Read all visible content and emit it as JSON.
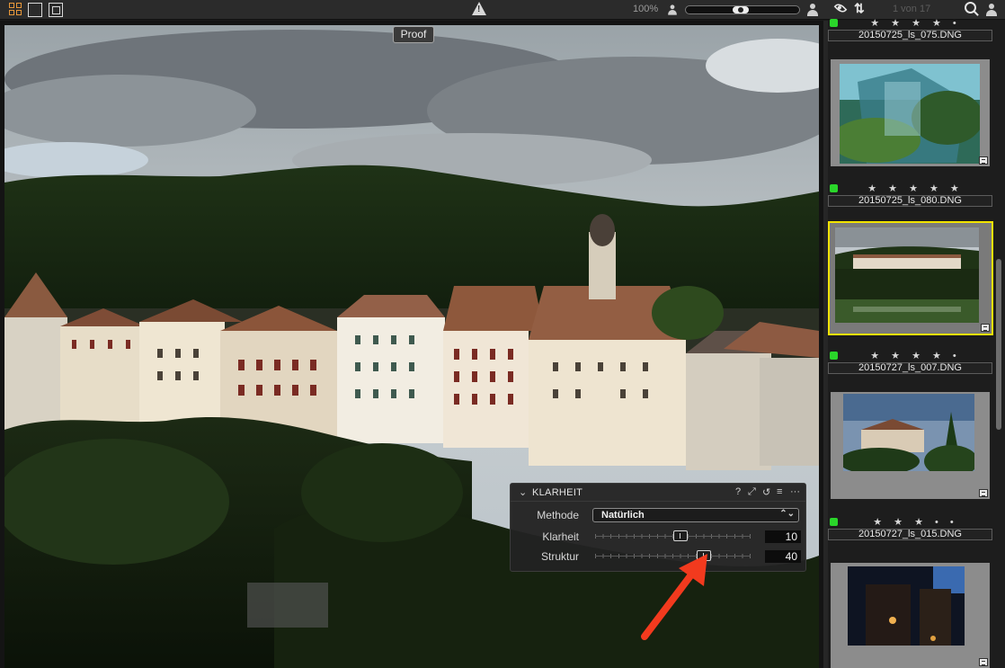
{
  "toolbar": {
    "zoom": "100%",
    "count": "1 von 17"
  },
  "viewer": {
    "proof_label": "Proof"
  },
  "clarity_panel": {
    "title": "KLARHEIT",
    "header_icons": [
      "help-icon",
      "adjust-icon",
      "reset-icon",
      "list-icon",
      "more-icon"
    ],
    "help_glyph": "?",
    "more_glyph": "···",
    "method_label": "Methode",
    "method_value": "Natürlich",
    "clarity_label": "Klarheit",
    "clarity_value": "10",
    "clarity_fraction": 0.55,
    "structure_label": "Struktur",
    "structure_value": "40",
    "structure_fraction": 0.7
  },
  "browser": {
    "thumbnails": [
      {
        "filename": "20150725_ls_075.DNG",
        "stars": "★ ★ ★ ★ •",
        "tag_color": "#2ad62a"
      },
      {
        "filename": "20150725_ls_080.DNG",
        "stars": "★ ★ ★ ★ ★",
        "tag_color": "#2ad62a"
      },
      {
        "filename": "20150727_ls_007.DNG",
        "stars": "★ ★ ★ ★ •",
        "tag_color": "#2ad62a"
      },
      {
        "filename": "20150727_ls_015.DNG",
        "stars": "★ ★ ★ • •",
        "tag_color": "#2ad62a"
      }
    ]
  },
  "colors": {
    "accent_orange": "#e8983a",
    "selection_yellow": "#f2e300",
    "annotation_red": "#f23a1e"
  }
}
